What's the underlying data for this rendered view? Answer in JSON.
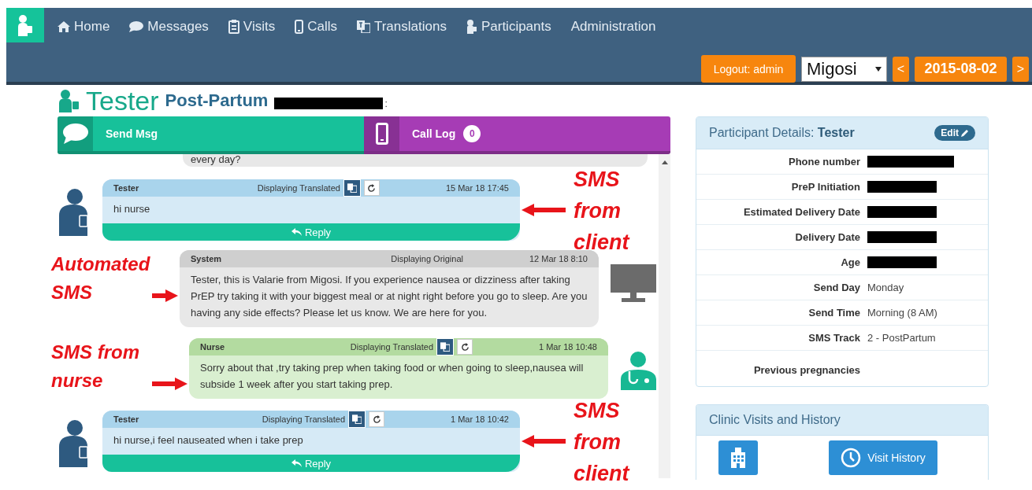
{
  "header": {
    "nav": [
      {
        "label": "Home"
      },
      {
        "label": "Messages"
      },
      {
        "label": "Visits"
      },
      {
        "label": "Calls"
      },
      {
        "label": "Translations"
      },
      {
        "label": "Participants"
      },
      {
        "label": "Administration"
      }
    ],
    "logout": "Logout: admin",
    "site_select": "Migosi",
    "prev": "<",
    "date": "2015-08-02",
    "next": ">"
  },
  "title": {
    "name": "Tester",
    "track": "Post-Partum",
    "suffix": ":"
  },
  "tabs": [
    {
      "label": "Send Msg",
      "color": "#17c19a"
    },
    {
      "label": "Call Log",
      "count": "0",
      "color": "#a63cb5"
    }
  ],
  "messages": [
    {
      "kind": "partial",
      "text": "every day?"
    },
    {
      "kind": "client",
      "sender": "Tester",
      "status": "Displaying Translated",
      "toggles": true,
      "time": "15 Mar 18 17:45",
      "text": "hi nurse",
      "reply": "Reply",
      "annotation": "SMS from client"
    },
    {
      "kind": "system",
      "sender": "System",
      "status": "Displaying Original",
      "toggles": false,
      "time": "12 Mar 18 8:10",
      "text": "Tester, this is Valarie from Migosi. If you experience nausea or dizziness after taking PrEP try taking it with your biggest meal or at night right before you go to sleep. Are you having any side effects? Please let us know. We are here for you.",
      "annotation": "Automated SMS"
    },
    {
      "kind": "nurse",
      "sender": "Nurse",
      "status": "Displaying Translated",
      "toggles": true,
      "time": "1 Mar 18 10:48",
      "text": "Sorry about that ,try taking prep when taking food or when going to sleep,nausea will subside 1 week after you start taking prep.",
      "annotation": "SMS from nurse"
    },
    {
      "kind": "client",
      "sender": "Tester",
      "status": "Displaying Translated",
      "toggles": true,
      "time": "1 Mar 18 10:42",
      "text": "hi nurse,i feel nauseated when i take prep",
      "reply": "Reply",
      "annotation": "SMS from client"
    }
  ],
  "details": {
    "title": "Participant Details:",
    "name": "Tester",
    "edit": "Edit",
    "rows": [
      {
        "label": "Phone number",
        "redacted": true
      },
      {
        "label": "PreP Initiation",
        "redacted": true
      },
      {
        "label": "Estimated Delivery Date",
        "redacted": true
      },
      {
        "label": "Delivery Date",
        "redacted": true
      },
      {
        "label": "Age",
        "redacted": true
      },
      {
        "label": "Send Day",
        "redacted": false,
        "value": "Monday"
      },
      {
        "label": "Send Time",
        "redacted": false,
        "value": "Morning (8 AM)"
      },
      {
        "label": "SMS Track",
        "redacted": false,
        "value": "2 - PostPartum"
      },
      {
        "label": "Previous pregnancies",
        "redacted": false
      }
    ]
  },
  "visits": {
    "title": "Clinic Visits and History",
    "button": "Visit History"
  }
}
